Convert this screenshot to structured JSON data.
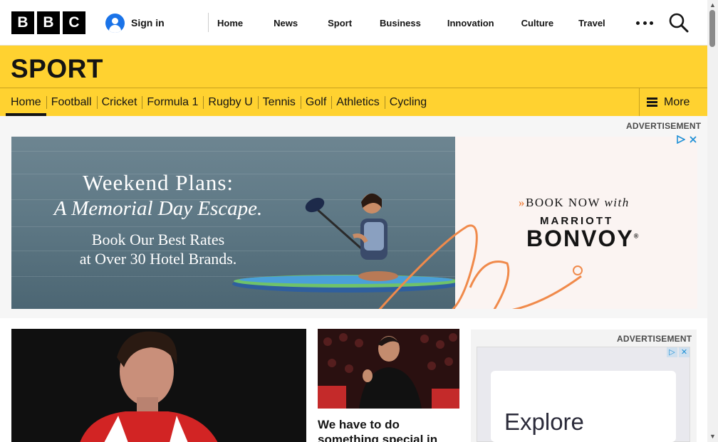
{
  "brand": {
    "logo_letters": [
      "B",
      "B",
      "C"
    ]
  },
  "header": {
    "sign_in": "Sign in",
    "nav": [
      "Home",
      "News",
      "Sport",
      "Business",
      "Innovation",
      "Culture",
      "Travel"
    ]
  },
  "sport": {
    "title": "SPORT",
    "nav": [
      "Home",
      "Football",
      "Cricket",
      "Formula 1",
      "Rugby U",
      "Tennis",
      "Golf",
      "Athletics",
      "Cycling"
    ],
    "active_index": 0,
    "more": "More"
  },
  "ad_top": {
    "label": "ADVERTISEMENT",
    "headline": "Weekend Plans:",
    "subhead": "A Memorial Day Escape.",
    "line3": "Book Our Best Rates",
    "line4": "at Over 30 Hotel Brands.",
    "book_now_arrow": "»",
    "book_now": "BOOK NOW",
    "with": "with",
    "brand_top": "MARRIOTT",
    "brand_main": "BONVOY",
    "brand_mark": "®"
  },
  "story": {
    "headline": "We have to do something special in"
  },
  "ad_side": {
    "label": "ADVERTISEMENT",
    "title": "Explore"
  },
  "colors": {
    "sport_yellow": "#ffd230",
    "accent_orange": "#f08a4b",
    "signin_blue": "#1a73e8"
  },
  "icons": [
    "user-icon",
    "more-dots-icon",
    "search-icon",
    "hamburger-icon",
    "adchoices-icon",
    "close-icon"
  ]
}
